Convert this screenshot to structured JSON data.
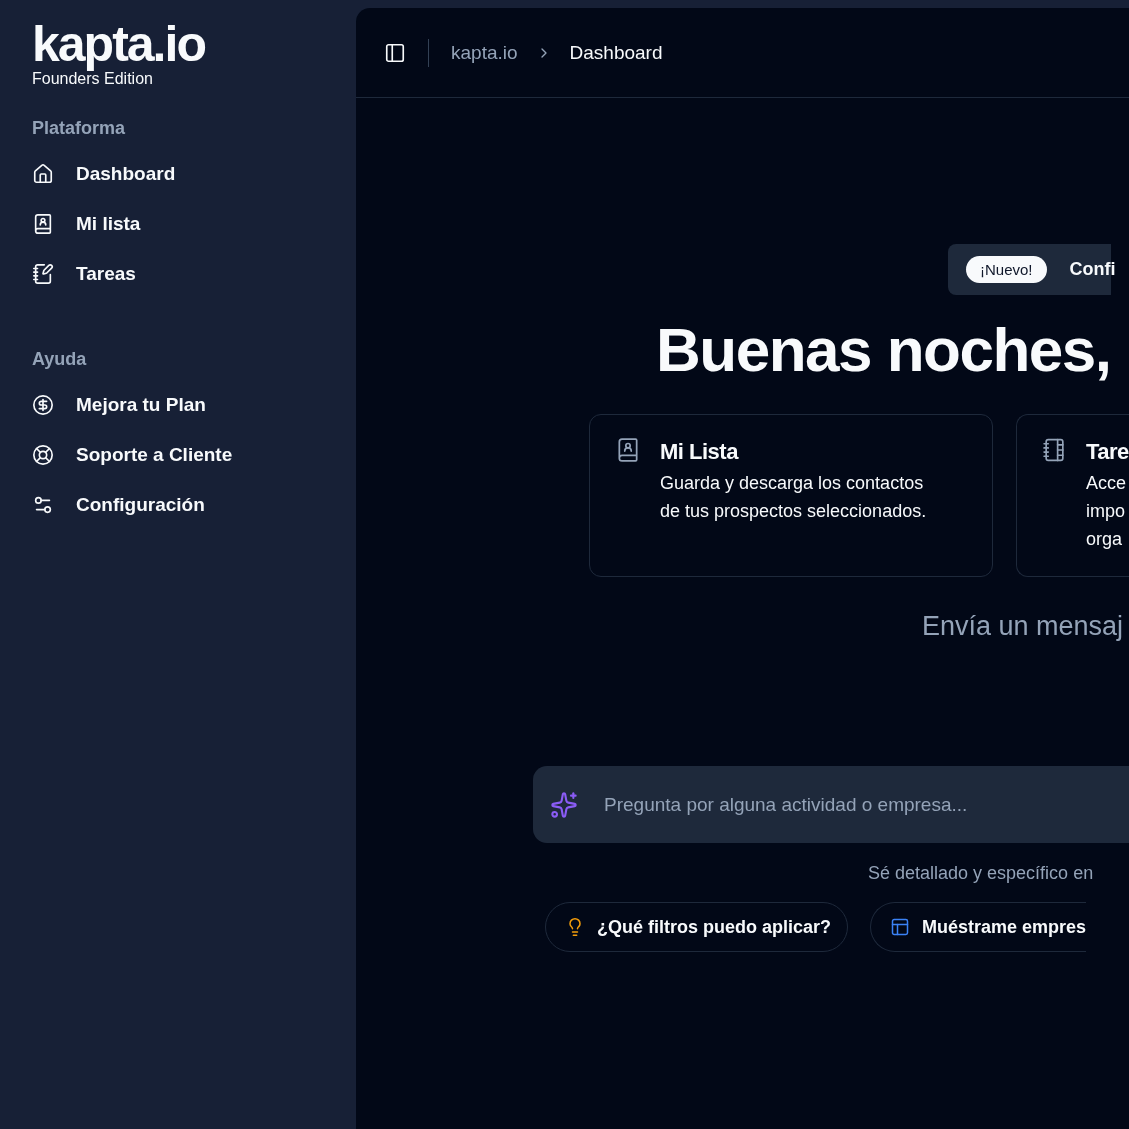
{
  "sidebar": {
    "logo": "kapta.io",
    "edition": "Founders Edition",
    "sections": [
      {
        "title": "Plataforma",
        "items": [
          {
            "label": "Dashboard"
          },
          {
            "label": "Mi lista"
          },
          {
            "label": "Tareas"
          }
        ]
      },
      {
        "title": "Ayuda",
        "items": [
          {
            "label": "Mejora tu Plan"
          },
          {
            "label": "Soporte a Cliente"
          },
          {
            "label": "Configuración"
          }
        ]
      }
    ]
  },
  "breadcrumb": [
    "kapta.io",
    "Dashboard"
  ],
  "announcement": {
    "badge": "¡Nuevo!",
    "text": "Confi"
  },
  "greeting": "Buenas noches,",
  "cards": [
    {
      "title": "Mi Lista",
      "description": "Guarda y descarga los contactos de tus prospectos seleccionados."
    },
    {
      "title": "Tare",
      "description": "Acce impo orga"
    }
  ],
  "prompt_title": "Envía un mensaj",
  "search": {
    "placeholder": "Pregunta por alguna actividad o empresa..."
  },
  "hint": "Sé detallado y específico en",
  "suggestions": [
    "¿Qué filtros puedo aplicar?",
    "Muéstrame empres"
  ]
}
